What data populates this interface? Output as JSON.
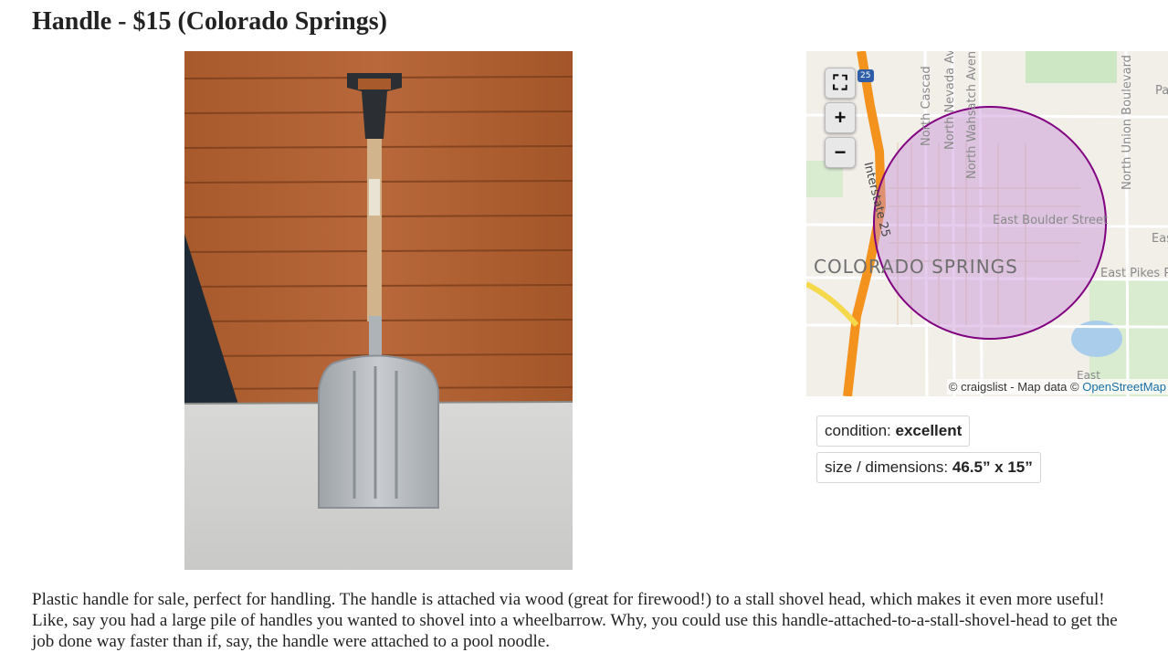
{
  "posting": {
    "title": "Handle - $15 (Colorado Springs)",
    "image_alt": "Shovel with plastic handle leaning against wooden wall"
  },
  "map": {
    "labels": {
      "city": "COLORADO SPRINGS",
      "boulder": "East Boulder Street",
      "pikes": "East Pikes P",
      "i25": "Interstate 25",
      "cascade": "North Cascad",
      "nevada": "North Nevada Av",
      "wahsatch": "North Wahsatch Avenu",
      "union": "North Union Boulevard",
      "hwy": "25",
      "pa": "Pa",
      "eas": "Eas",
      "east_bottom": "East"
    },
    "controls": {
      "fullscreen": "⛶",
      "zoom_in": "+",
      "zoom_out": "−"
    },
    "attribution_prefix": "© craigslist - Map data ©",
    "attribution_link": "OpenStreetMap"
  },
  "attributes": [
    {
      "label": "condition:",
      "value": "excellent"
    },
    {
      "label": "size / dimensions:",
      "value": "46.5” x 15”"
    }
  ],
  "description": "Plastic handle for sale, perfect for handling. The handle is attached via wood (great for firewood!) to a stall shovel head, which makes it even more useful! Like, say you had a large pile of handles you wanted to shovel into a wheelbarrow. Why, you could use this handle-attached-to-a-stall-shovel-head to get the job done way faster than if, say, the handle were attached to a pool noodle.",
  "colors": {
    "map_circle": "#800080",
    "highway": "#f3931e",
    "link": "#1a6fa8"
  }
}
